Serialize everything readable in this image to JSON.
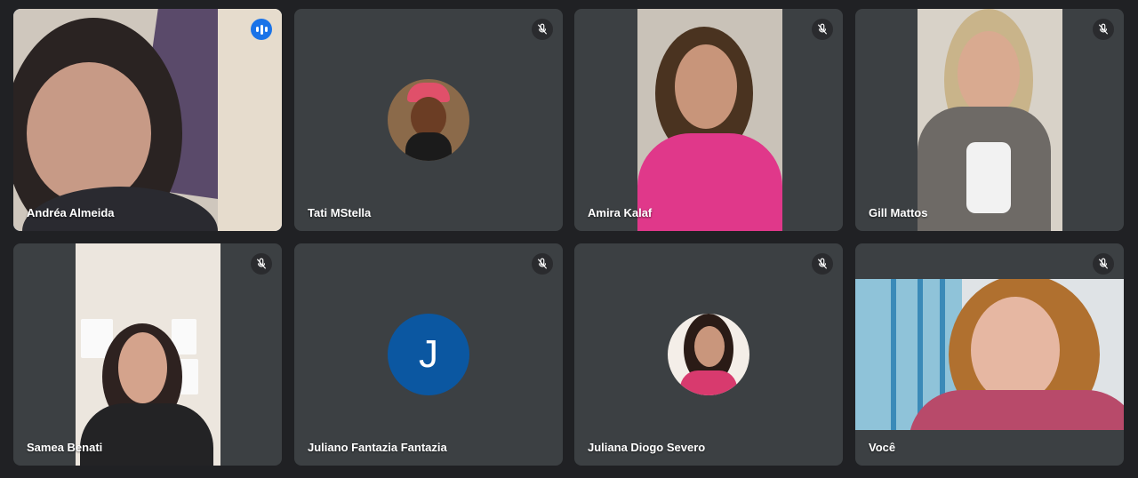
{
  "participants": [
    {
      "name": "Andréa Almeida",
      "state": "speaking"
    },
    {
      "name": "Tati MStella",
      "state": "muted"
    },
    {
      "name": "Amira Kalaf",
      "state": "muted"
    },
    {
      "name": "Gill Mattos",
      "state": "muted"
    },
    {
      "name": "Samea Benati",
      "state": "muted"
    },
    {
      "name": "Juliano Fantazia Fantazia",
      "state": "muted",
      "initial": "J"
    },
    {
      "name": "Juliana Diogo Severo",
      "state": "muted"
    },
    {
      "name": "Você",
      "state": "muted"
    }
  ],
  "colors": {
    "background": "#202124",
    "tile": "#3c4043",
    "active_border": "#8ab4f8",
    "speaking_badge": "#1a73e8",
    "initial_avatar": "#0b57a1"
  },
  "icons": {
    "muted": "mic-off-icon",
    "speaking": "audio-level-icon"
  }
}
